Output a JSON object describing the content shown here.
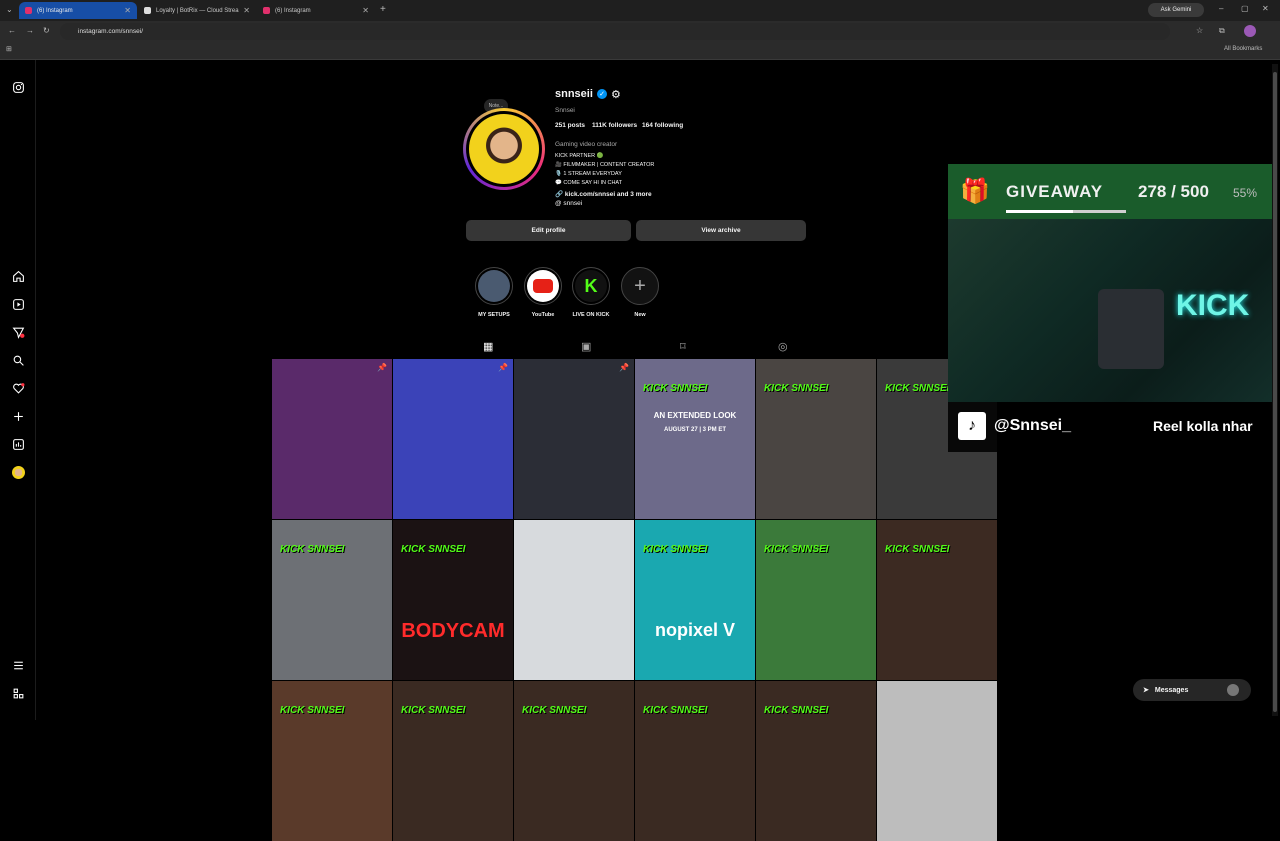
{
  "browser": {
    "tabs": [
      {
        "title": "(6) Instagram",
        "active": true
      },
      {
        "title": "Loyalty | BotRix — Cloud Strea",
        "active": false
      },
      {
        "title": "(6) Instagram",
        "active": false
      }
    ],
    "ask_gemini": "Ask Gemini",
    "url": "instagram.com/snnsei/",
    "all_bookmarks": "All Bookmarks"
  },
  "profile": {
    "note_label": "Note...",
    "username": "snnseii",
    "display_name": "Snnsei",
    "stats": {
      "posts": "251 posts",
      "followers": "111K followers",
      "following": "164 following"
    },
    "category": "Gaming video creator",
    "bio_lines": [
      "KICK PARTNER 🟢",
      "🎥 FILMMAKER | CONTENT CREATOR",
      "🎙️ 1 STREAM EVERYDAY",
      "💬 COME SAY HI IN CHAT"
    ],
    "link_text": "kick.com/snnsei and 3 more",
    "threads_handle": "snnsei",
    "edit_profile_label": "Edit profile",
    "view_archive_label": "View archive"
  },
  "highlights": [
    {
      "label": "MY SETUPS"
    },
    {
      "label": "YouTube"
    },
    {
      "label": "LIVE ON KICK"
    },
    {
      "label": "New"
    }
  ],
  "grid": {
    "kick_text": "KICK SNNSEI",
    "posts": [
      {
        "bg": "#5a2a6a",
        "pinned": true,
        "kick": false
      },
      {
        "bg": "#3b43b8",
        "pinned": true,
        "kick": false
      },
      {
        "bg": "#2b2d36",
        "pinned": true,
        "kick": false
      },
      {
        "bg": "#6d6a8a",
        "pinned": false,
        "kick": true
      },
      {
        "bg": "#4a4542",
        "pinned": false,
        "kick": true
      },
      {
        "bg": "#3a3a3a",
        "pinned": false,
        "kick": true
      },
      {
        "bg": "#6d7075",
        "pinned": false,
        "kick": true
      },
      {
        "bg": "#1b1213",
        "pinned": false,
        "kick": true
      },
      {
        "bg": "#d7dadd",
        "pinned": false,
        "kick": false
      },
      {
        "bg": "#1aa8b0",
        "pinned": false,
        "kick": true
      },
      {
        "bg": "#3b7a3a",
        "pinned": false,
        "kick": true
      },
      {
        "bg": "#3c2a22",
        "pinned": false,
        "kick": true
      },
      {
        "bg": "#5a3a2a",
        "pinned": false,
        "kick": true
      },
      {
        "bg": "#3a2a22",
        "pinned": false,
        "kick": true
      },
      {
        "bg": "#3a2a22",
        "pinned": false,
        "kick": true
      },
      {
        "bg": "#3a2a22",
        "pinned": false,
        "kick": true
      },
      {
        "bg": "#3a2a22",
        "pinned": false,
        "kick": true
      },
      {
        "bg": "#bdbdbd",
        "pinned": false,
        "kick": false
      }
    ],
    "post_captions": [
      "BODYCAM",
      "nopixel V",
      "AN EXTENDED LOOK",
      "AUGUST 27 | 3 PM ET"
    ]
  },
  "overlay": {
    "giveaway_title": "GIVEAWAY",
    "giveaway_count": "278 / 500",
    "giveaway_percent": "55%",
    "progress_value": 0.556,
    "tiktok_handle": "@Snnsei_",
    "ticker_text": "Reel kolla nhar",
    "kick_sign": "KICK"
  },
  "messages": {
    "label": "Messages"
  },
  "colors": {
    "accent": "#0095f6",
    "kick_green": "#53fc18",
    "notification": "#ff3040"
  }
}
